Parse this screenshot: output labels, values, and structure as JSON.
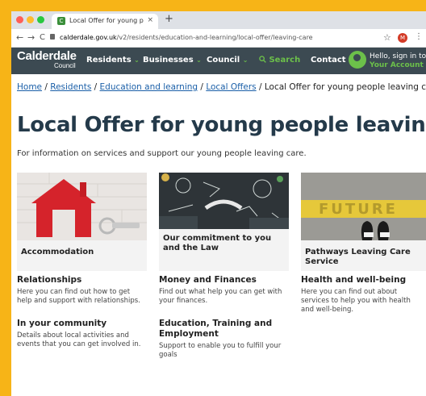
{
  "browser": {
    "tab_title": "Local Offer for young people le",
    "tab_close": "×",
    "new_tab": "+",
    "back": "←",
    "forward": "→",
    "reload": "C",
    "url_host": "calderdale.gov.uk",
    "url_path": "/v2/residents/education-and-learning/local-offer/leaving-care",
    "profile_initial": "M",
    "star": "☆",
    "menu": "⋮",
    "favicon": "C"
  },
  "header": {
    "logo_main": "Calderdale",
    "logo_sub": "Council",
    "nav": [
      {
        "label": "Residents"
      },
      {
        "label": "Businesses"
      },
      {
        "label": "Council"
      }
    ],
    "search_label": "Search",
    "contact_label": "Contact",
    "account_line1": "Hello, sign in to",
    "account_line2": "Your Account",
    "chevron": "⌄"
  },
  "breadcrumb": {
    "items": [
      "Home",
      "Residents",
      "Education and learning",
      "Local Offers"
    ],
    "current": "Local Offer for young people leaving care",
    "sep": "/"
  },
  "page": {
    "title": "Local Offer for young people leaving care",
    "lead": "For information on services and support our young people leaving care."
  },
  "cards": [
    {
      "caption": "Accommodation"
    },
    {
      "caption": "Our commitment to you and the Law"
    },
    {
      "caption": "Pathways Leaving Care Service"
    }
  ],
  "future_text": "FUTURE",
  "sections": [
    {
      "heading": "Relationships",
      "desc": "Here you can find out how to get help and support with relationships."
    },
    {
      "heading": "Money and Finances",
      "desc": "Find out what help you can get with your finances."
    },
    {
      "heading": "Health and well-being",
      "desc": "Here you can find out about services to help you with health and well-being."
    },
    {
      "heading": "In your community",
      "desc": "Details about local activities and events that you can get involved in."
    },
    {
      "heading": "Education, Training and Employment",
      "desc": "Support to enable you to fulfill your goals"
    }
  ],
  "colors": {
    "frame": "#f7b417",
    "header": "#3c4a52",
    "accent": "#6cc04a",
    "link": "#1a5fa8",
    "title": "#243a4a"
  }
}
